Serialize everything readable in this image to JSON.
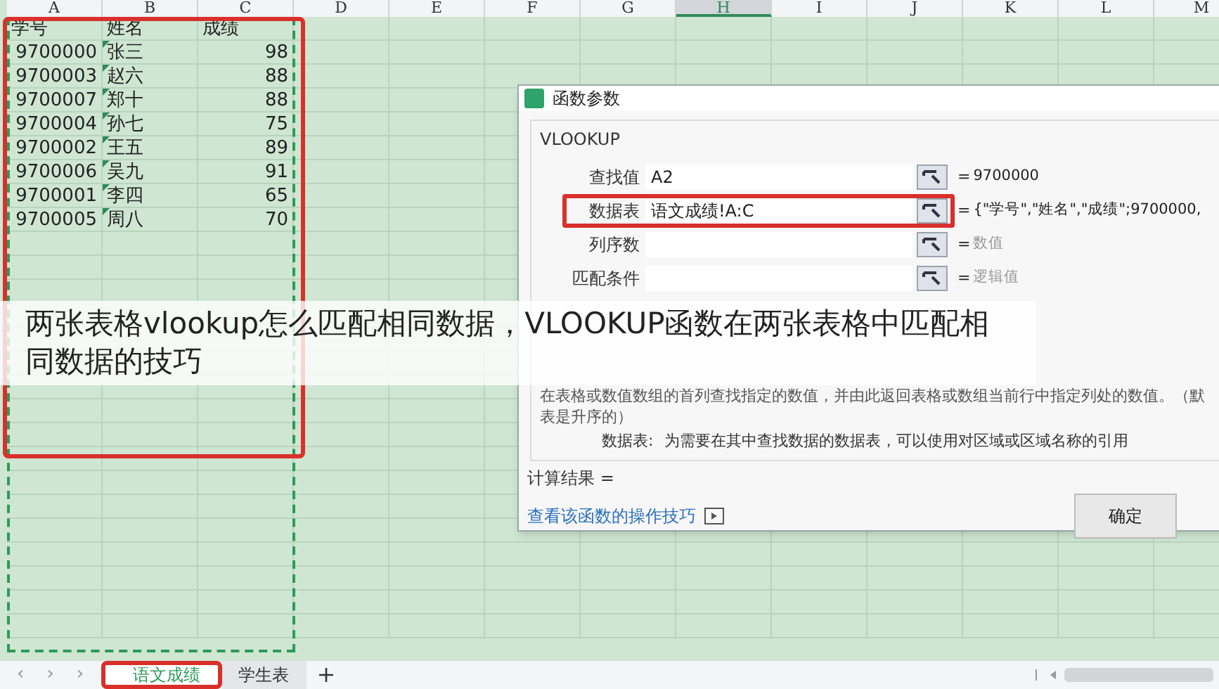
{
  "sheet": {
    "columns": [
      {
        "label": "A",
        "selected": false
      },
      {
        "label": "B",
        "selected": false
      },
      {
        "label": "C",
        "selected": false
      },
      {
        "label": "D",
        "selected": false
      },
      {
        "label": "E",
        "selected": false
      },
      {
        "label": "F",
        "selected": false
      },
      {
        "label": "G",
        "selected": false
      },
      {
        "label": "H",
        "selected": true
      },
      {
        "label": "I",
        "selected": false
      },
      {
        "label": "J",
        "selected": false
      },
      {
        "label": "K",
        "selected": false
      },
      {
        "label": "L",
        "selected": false
      },
      {
        "label": "M",
        "selected": false
      }
    ],
    "header_row": [
      "学号",
      "姓名",
      "成绩"
    ],
    "rows": [
      [
        "9700000",
        "张三",
        "98"
      ],
      [
        "9700003",
        "赵六",
        "88"
      ],
      [
        "9700007",
        "郑十",
        "88"
      ],
      [
        "9700004",
        "孙七",
        "75"
      ],
      [
        "9700002",
        "王五",
        "89"
      ],
      [
        "9700006",
        "吴九",
        "91"
      ],
      [
        "9700001",
        "李四",
        "65"
      ],
      [
        "9700005",
        "周八",
        "70"
      ]
    ]
  },
  "dialog": {
    "title": "函数参数",
    "function_name": "VLOOKUP",
    "params": [
      {
        "label": "查找值",
        "value": "A2",
        "sign": "=",
        "result": "9700000",
        "muted": false,
        "highlighted": false
      },
      {
        "label": "数据表",
        "value": "语文成绩!A:C",
        "sign": "=",
        "result": "{\"学号\",\"姓名\",\"成绩\";9700000,",
        "muted": false,
        "highlighted": true
      },
      {
        "label": "列序数",
        "sign": "=",
        "result": "数值",
        "muted": true,
        "highlighted": false
      },
      {
        "label": "匹配条件",
        "sign": "=",
        "result": "逻辑值",
        "muted": true,
        "highlighted": false
      }
    ],
    "description": [
      "在表格或数值数组的首列查找指定的数值，并由此返回表格或数组当前行中指定列处的数值。（默",
      "表是升序的）"
    ],
    "param_help": {
      "label": "数据表:",
      "text": "为需要在其中查找数据的数据表，可以使用对区域或区域名称的引用"
    },
    "calc_result": "计算结果 =",
    "help_link": "查看该函数的操作技巧",
    "ok_button": "确定"
  },
  "sheet_nav": [
    "‹",
    "›",
    "›"
  ],
  "caption": "两张表格vlookup怎么匹配相同数据，VLOOKUP函数在两张表格中匹配相同数据的技巧",
  "sheet_tabs": [
    {
      "label": "语文成绩",
      "selected": true,
      "highlighted": true
    },
    {
      "label": "学生表",
      "selected": false,
      "highlighted": false
    }
  ]
}
